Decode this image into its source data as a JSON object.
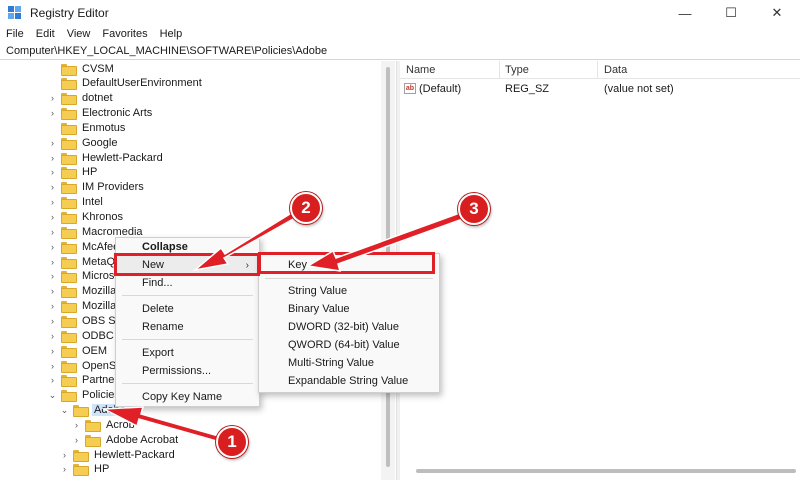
{
  "window": {
    "title": "Registry Editor",
    "minimize": "—",
    "maximize": "☐",
    "close": "✕"
  },
  "menubar": [
    "File",
    "Edit",
    "View",
    "Favorites",
    "Help"
  ],
  "address": "Computer\\HKEY_LOCAL_MACHINE\\SOFTWARE\\Policies\\Adobe",
  "tree": [
    {
      "label": "CVSM",
      "expandable": false
    },
    {
      "label": "DefaultUserEnvironment",
      "expandable": false
    },
    {
      "label": "dotnet",
      "expandable": true
    },
    {
      "label": "Electronic Arts",
      "expandable": true
    },
    {
      "label": "Enmotus",
      "expandable": false
    },
    {
      "label": "Google",
      "expandable": true
    },
    {
      "label": "Hewlett-Packard",
      "expandable": true
    },
    {
      "label": "HP",
      "expandable": true
    },
    {
      "label": "IM Providers",
      "expandable": true
    },
    {
      "label": "Intel",
      "expandable": true
    },
    {
      "label": "Khronos",
      "expandable": true
    },
    {
      "label": "Macromedia",
      "expandable": true
    },
    {
      "label": "McAfee",
      "expandable": true
    },
    {
      "label": "MetaQu",
      "expandable": true
    },
    {
      "label": "Microso",
      "expandable": true
    },
    {
      "label": "Mozilla",
      "expandable": true
    },
    {
      "label": "MozillaF",
      "expandable": true
    },
    {
      "label": "OBS Stu",
      "expandable": true
    },
    {
      "label": "ODBC",
      "expandable": true
    },
    {
      "label": "OEM",
      "expandable": true
    },
    {
      "label": "OpenSSl",
      "expandable": true
    },
    {
      "label": "Partner",
      "expandable": true
    },
    {
      "label": "Policies",
      "expandable": true,
      "expanded": true
    },
    {
      "label": "Adobe",
      "expandable": true,
      "expanded": true,
      "selected": true
    },
    {
      "label": "Acrob",
      "expandable": true
    },
    {
      "label": "Adobe Acrobat",
      "expandable": true
    },
    {
      "label": "Hewlett-Packard",
      "expandable": true
    },
    {
      "label": "HP",
      "expandable": true
    }
  ],
  "list": {
    "headers": {
      "name": "Name",
      "type": "Type",
      "data": "Data"
    },
    "rows": [
      {
        "icon": "ab",
        "name": "(Default)",
        "type": "REG_SZ",
        "data": "(value not set)"
      }
    ]
  },
  "context_menu": {
    "items": [
      {
        "label": "Collapse",
        "bold": true
      },
      {
        "label": "New",
        "submenu": true,
        "arrow": "›"
      },
      {
        "label": "Find..."
      },
      {
        "label": "Delete"
      },
      {
        "label": "Rename"
      },
      {
        "label": "Export"
      },
      {
        "label": "Permissions..."
      },
      {
        "label": "Copy Key Name"
      }
    ]
  },
  "submenu": {
    "items": [
      {
        "label": "Key"
      },
      {
        "label": "String Value"
      },
      {
        "label": "Binary Value"
      },
      {
        "label": "DWORD (32-bit) Value"
      },
      {
        "label": "QWORD (64-bit) Value"
      },
      {
        "label": "Multi-String Value"
      },
      {
        "label": "Expandable String Value"
      }
    ]
  },
  "annotations": {
    "badges": [
      "1",
      "2",
      "3"
    ],
    "color": "#e01f26"
  },
  "colors": {
    "selection": "#cfe4fb",
    "folder": "#f5cd52",
    "accent": "#2f7bd6"
  }
}
